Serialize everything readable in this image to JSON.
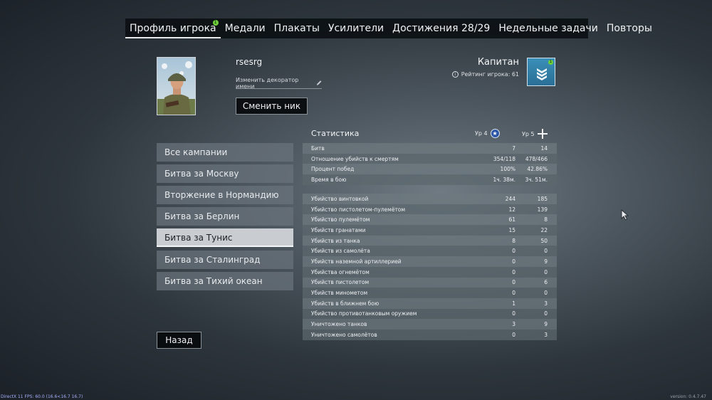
{
  "tabs": [
    {
      "label": "Профиль игрока",
      "badge": "1"
    },
    {
      "label": "Медали"
    },
    {
      "label": "Плакаты"
    },
    {
      "label": "Усилители"
    },
    {
      "label": "Достижения 28/29"
    },
    {
      "label": "Недельные задачи"
    },
    {
      "label": "Повторы"
    }
  ],
  "profile": {
    "nickname": "rsesrg",
    "decorator_link": "Изменить декоратор имени",
    "change_nick_button": "Сменить ник"
  },
  "rank": {
    "title": "Капитан",
    "rating": "Рейтинг игрока: 61",
    "badge_dot": "1",
    "info_icon": "i"
  },
  "campaigns": [
    "Все кампании",
    "Битва за Москву",
    "Вторжение в Нормандию",
    "Битва за Берлин",
    "Битва за Тунис",
    "Битва за Сталинград",
    "Битва за Тихий океан"
  ],
  "active_campaign_index": 4,
  "stats": {
    "title": "Статистика",
    "level1": "Ур 4",
    "level2": "Ур 5",
    "level1_icon": "★",
    "summary_rows": [
      {
        "label": "Битв",
        "v1": "7",
        "v2": "14"
      },
      {
        "label": "Отношение убийств к смертям",
        "v1": "354/118",
        "v2": "478/466"
      },
      {
        "label": "Процент побед",
        "v1": "100%",
        "v2": "42.86%"
      },
      {
        "label": "Время в бою",
        "v1": "1ч. 38м.",
        "v2": "3ч. 51м."
      }
    ],
    "kill_rows": [
      {
        "label": "Убийство винтовкой",
        "v1": "244",
        "v2": "185"
      },
      {
        "label": "Убийство пистолетом-пулемётом",
        "v1": "12",
        "v2": "139"
      },
      {
        "label": "Убийство пулемётом",
        "v1": "61",
        "v2": "8"
      },
      {
        "label": "Убийств гранатами",
        "v1": "15",
        "v2": "22"
      },
      {
        "label": "Убийств из танка",
        "v1": "8",
        "v2": "50"
      },
      {
        "label": "Убийств из самолёта",
        "v1": "0",
        "v2": "0"
      },
      {
        "label": "Убийств наземной артиллерией",
        "v1": "0",
        "v2": "9"
      },
      {
        "label": "Убийства огнемётом",
        "v1": "0",
        "v2": "0"
      },
      {
        "label": "Убийств пистолетом",
        "v1": "0",
        "v2": "6"
      },
      {
        "label": "Убийств минометом",
        "v1": "0",
        "v2": "0"
      },
      {
        "label": "Убийств в ближнем бою",
        "v1": "1",
        "v2": "3"
      },
      {
        "label": "Убийство противотанковым оружием",
        "v1": "0",
        "v2": "0"
      },
      {
        "label": "Уничтожено танков",
        "v1": "3",
        "v2": "9"
      },
      {
        "label": "Уничтожено самолётов",
        "v1": "0",
        "v2": "3"
      }
    ]
  },
  "back_button": "Назад",
  "footer": {
    "fps": "DirectX 11 FPS: 60.0 (16.6<16.7 16.7)",
    "version": "version: 0.4.7.47"
  }
}
